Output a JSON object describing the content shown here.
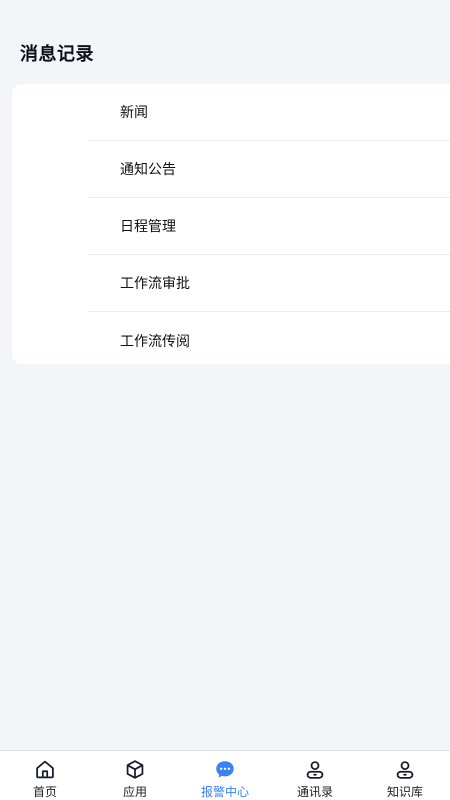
{
  "header": {
    "title": "消息记录"
  },
  "menu": {
    "items": [
      {
        "label": "新闻"
      },
      {
        "label": "通知公告"
      },
      {
        "label": "日程管理"
      },
      {
        "label": "工作流审批"
      },
      {
        "label": "工作流传阅"
      }
    ]
  },
  "tabbar": {
    "active_color": "#3b82f6",
    "items": [
      {
        "label": "首页",
        "icon": "home-icon"
      },
      {
        "label": "应用",
        "icon": "cube-icon"
      },
      {
        "label": "报警中心",
        "icon": "chat-bubble-icon"
      },
      {
        "label": "通讯录",
        "icon": "user-icon"
      },
      {
        "label": "知识库",
        "icon": "user-icon"
      }
    ],
    "active_index": 2
  }
}
